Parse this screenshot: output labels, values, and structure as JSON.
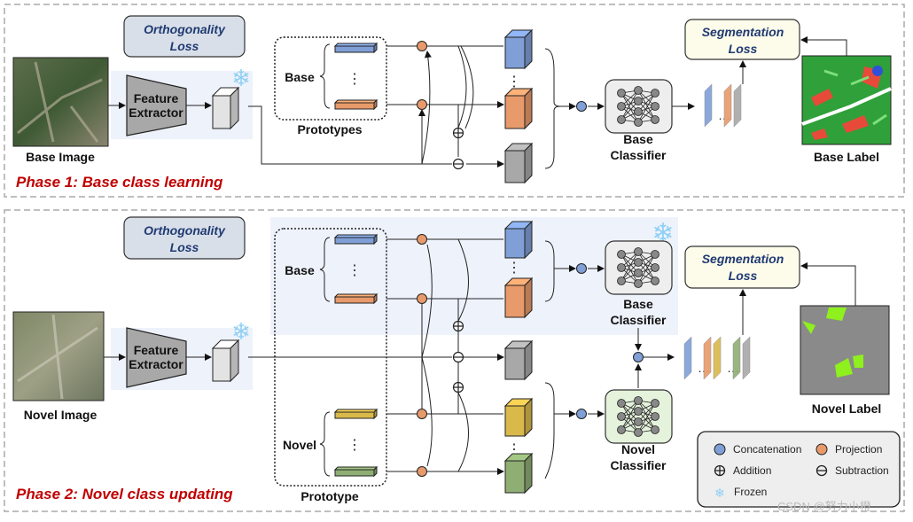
{
  "phase1": {
    "title": "Phase 1: Base class learning",
    "orthogonality_loss": [
      "Orthogonality",
      "Loss"
    ],
    "input_label": "Base Image",
    "feature_extractor": [
      "Feature",
      "Extractor"
    ],
    "prototype_group": "Base",
    "prototypes_label": "Prototypes",
    "classifier": [
      "Base",
      "Classifier"
    ],
    "segmentation_loss": [
      "Segmentation",
      "Loss"
    ],
    "output_label": "Base Label"
  },
  "phase2": {
    "title": "Phase 2: Novel class updating",
    "orthogonality_loss": [
      "Orthogonality",
      "Loss"
    ],
    "input_label": "Novel Image",
    "feature_extractor": [
      "Feature",
      "Extractor"
    ],
    "prototype_group_base": "Base",
    "prototype_group_novel": "Novel",
    "prototypes_label": "Prototype",
    "base_classifier": [
      "Base",
      "Classifier"
    ],
    "novel_classifier": [
      "Novel",
      "Classifier"
    ],
    "segmentation_loss": [
      "Segmentation",
      "Loss"
    ],
    "output_label": "Novel Label"
  },
  "legend": {
    "concatenation": "Concatenation",
    "projection": "Projection",
    "addition": "Addition",
    "subtraction": "Subtraction",
    "frozen": "Frozen"
  },
  "watermark": "CSDN @努力小橙",
  "colors": {
    "blue": "#7f9fd6",
    "orange": "#e89a6a",
    "gray": "#a8a8a8",
    "yellow": "#d9b94a",
    "green": "#8fae73",
    "phase_title": "#c00000",
    "loss_text": "#1f3a73",
    "frozen": "#8fd0f5"
  }
}
